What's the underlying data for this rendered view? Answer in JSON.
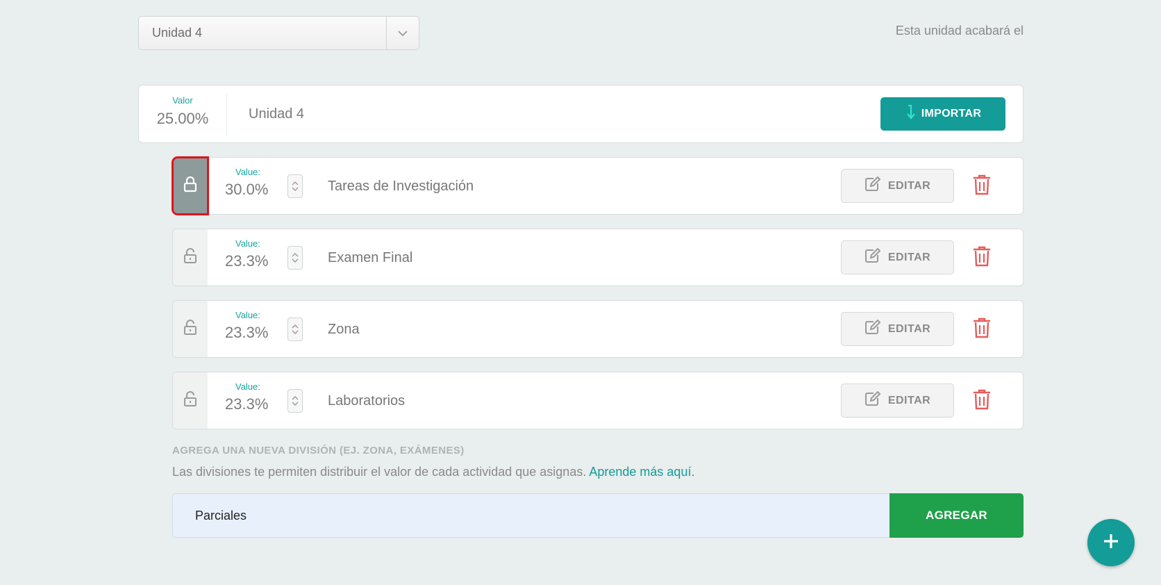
{
  "unit_select": {
    "value": "Unidad 4"
  },
  "end_text": "Esta unidad acabará el",
  "unit_card": {
    "value_label": "Valor",
    "value": "25.00%",
    "name": "Unidad 4",
    "import_label": "IMPORTAR"
  },
  "divisions": [
    {
      "value_label": "Value:",
      "value": "30.0%",
      "name": "Tareas de Investigación",
      "edit_label": "EDITAR",
      "locked": true
    },
    {
      "value_label": "Value:",
      "value": "23.3%",
      "name": "Examen Final",
      "edit_label": "EDITAR",
      "locked": false
    },
    {
      "value_label": "Value:",
      "value": "23.3%",
      "name": "Zona",
      "edit_label": "EDITAR",
      "locked": false
    },
    {
      "value_label": "Value:",
      "value": "23.3%",
      "name": "Laboratorios",
      "edit_label": "EDITAR",
      "locked": false
    }
  ],
  "add_section": {
    "title": "AGREGA UNA NUEVA DIVISIÓN (EJ. ZONA, EXÁMENES)",
    "description": "Las divisiones te permiten distribuir el valor de cada actividad que asignas.",
    "learn_more": "Aprende más aquí.",
    "input_value": "Parciales",
    "add_label": "AGREGAR"
  },
  "colors": {
    "accent": "#139c98",
    "success": "#1fa04b",
    "danger": "#e65c5c",
    "highlight": "#e0141b"
  }
}
